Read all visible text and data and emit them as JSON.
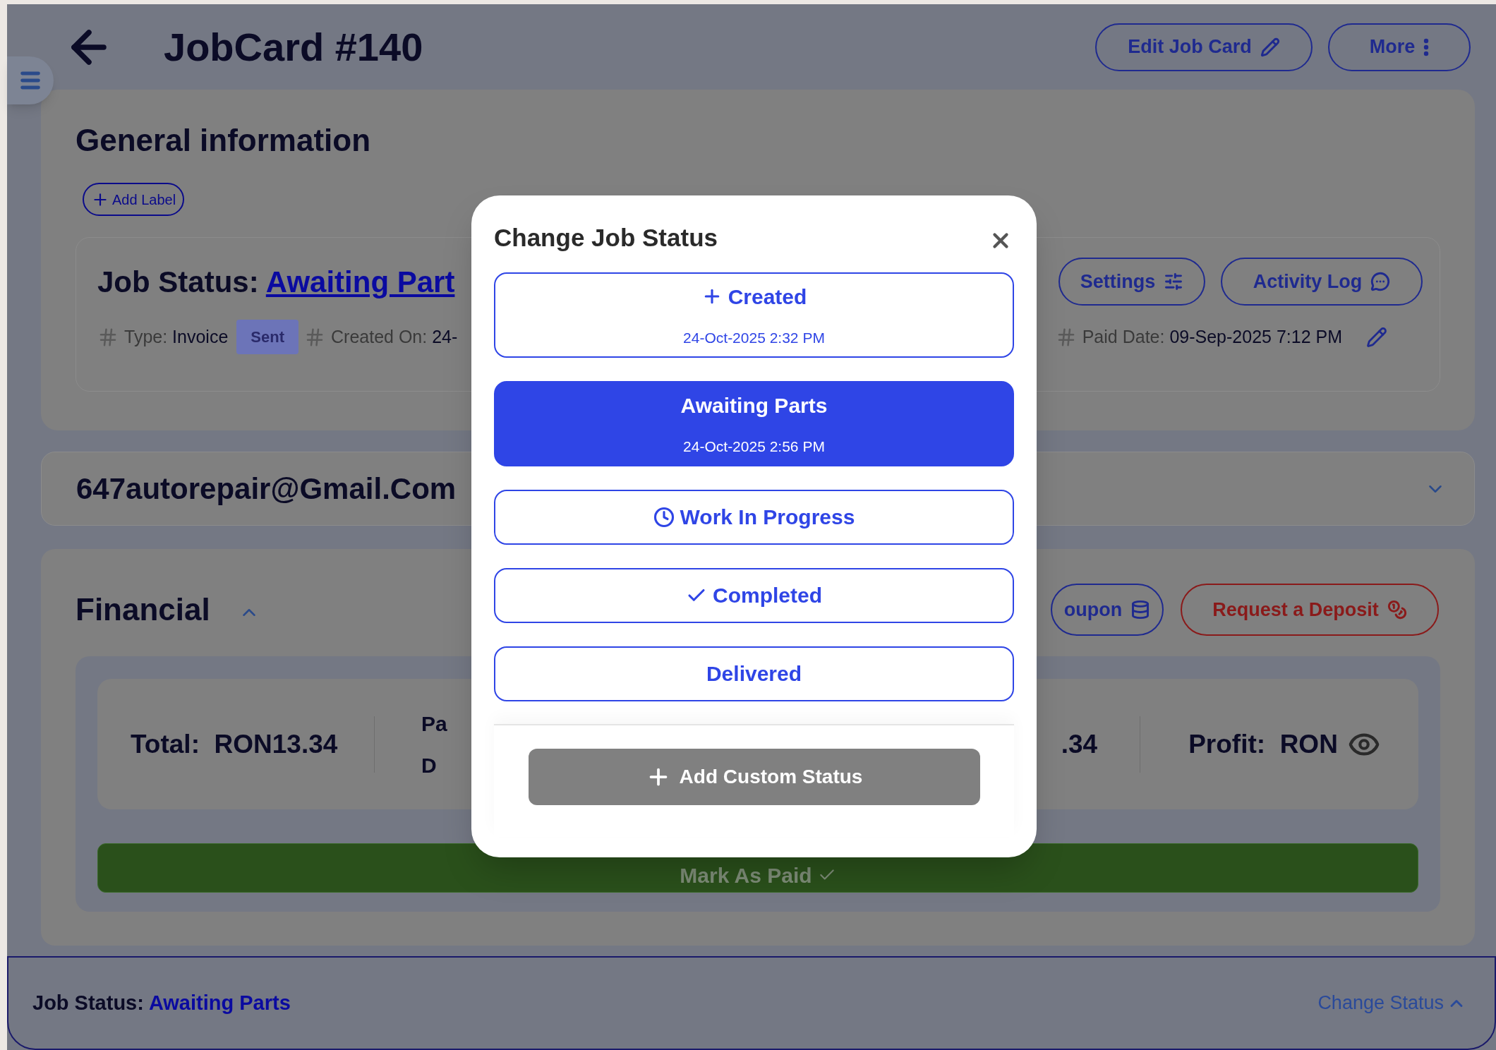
{
  "header": {
    "title": "JobCard #140",
    "buttons": [
      {
        "label": "Edit Job Card"
      },
      {
        "label": "More"
      }
    ]
  },
  "general": {
    "title": "General information",
    "add_label": "Add Label",
    "status_label": "Job Status:",
    "status_value": "Awaiting Part",
    "buttons": [
      {
        "label": "Settings"
      },
      {
        "label": "Activity Log"
      }
    ],
    "meta": [
      {
        "label": "Type:",
        "value": "Invoice",
        "badge": "Sent"
      },
      {
        "label": "Created On:",
        "value": "24-"
      }
    ],
    "paid_date": {
      "label": "Paid Date:",
      "value": "09-Sep-2025 7:12 PM"
    }
  },
  "customer": {
    "email": "647autorepair@Gmail.Com",
    "expanded": false
  },
  "financial": {
    "title": "Financial",
    "expanded": true,
    "buttons": [
      {
        "label": "oupon",
        "kind": "normal"
      },
      {
        "label": "Request a Deposit",
        "kind": "danger"
      }
    ],
    "total": {
      "label": "Total:",
      "value": "RON13.34"
    },
    "column_2": [
      "Pa",
      "D"
    ],
    "column_3": ".34",
    "profit": {
      "label": "Profit:",
      "value": "RON"
    },
    "mark_paid": "Mark As Paid"
  },
  "footer": {
    "label": "Job Status:",
    "value": "Awaiting Parts",
    "action": "Change Status"
  },
  "modal": {
    "title": "Change Job Status",
    "statuses": [
      {
        "label": "Created",
        "date": "24-Oct-2025 2:32 PM",
        "kind": "created",
        "selected": false
      },
      {
        "label": "Awaiting Parts",
        "date": "24-Oct-2025 2:56 PM",
        "kind": "custom",
        "selected": true
      },
      {
        "label": "Work In Progress",
        "kind": "progress",
        "selected": false
      },
      {
        "label": "Completed",
        "kind": "completed",
        "selected": false
      },
      {
        "label": "Delivered",
        "kind": "custom",
        "selected": false
      }
    ],
    "add_button": "Add Custom Status"
  }
}
